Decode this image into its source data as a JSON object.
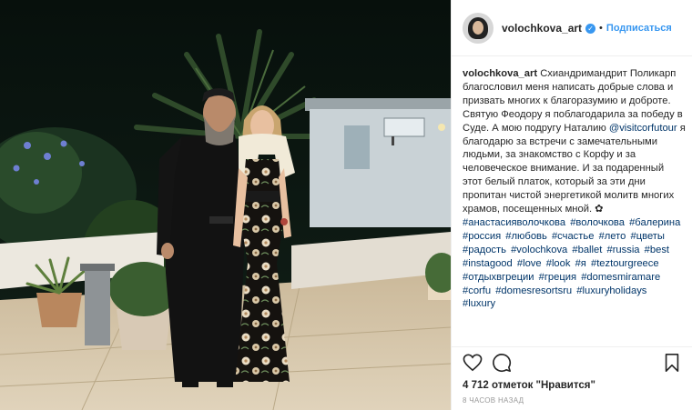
{
  "header": {
    "username": "volochkova_art",
    "verified_icon": "verified-badge-icon",
    "separator": "•",
    "follow_label": "Подписаться"
  },
  "caption": {
    "username": "volochkova_art",
    "text": "Схиандримандрит Поликарп благословил меня написать добрые слова и призвать многих к благоразумию и доброте. Святую Феодору я поблагодарила за победу в Суде. А мою подругу Наталию",
    "mention": "@visitcorfutour",
    "text2": " я благодарю за встречи с замечательными людьми, за знакомство с Корфу и за человеческое внимание. И за подаренный этот белый платок, который за эти дни пропитан чистой энергетикой молитв многих храмов, посещенных мной. ✿",
    "hashtags": [
      "#анастасияволочкова",
      "#волочкова",
      "#балерина",
      "#россия",
      "#любовь",
      "#счастье",
      "#лето",
      "#цветы",
      "#радость",
      "#volochkova",
      "#ballet",
      "#russia",
      "#best",
      "#instagood",
      "#love",
      "#look",
      "#я",
      "#teztourgreece",
      "#отдыхвгреции",
      "#греция",
      "#domesmiramare",
      "#corfu",
      "#domesresortsru",
      "#luxuryholidays",
      "#luxury"
    ]
  },
  "actions": {
    "like_icon": "heart-icon",
    "comment_icon": "comment-icon",
    "save_icon": "bookmark-icon"
  },
  "likes": "4 712 отметок \"Нравится\"",
  "timestamp": "8 ЧАСОВ НАЗАД",
  "colors": {
    "link": "#003569",
    "follow": "#3897f0",
    "text": "#262626",
    "meta": "#999999"
  }
}
